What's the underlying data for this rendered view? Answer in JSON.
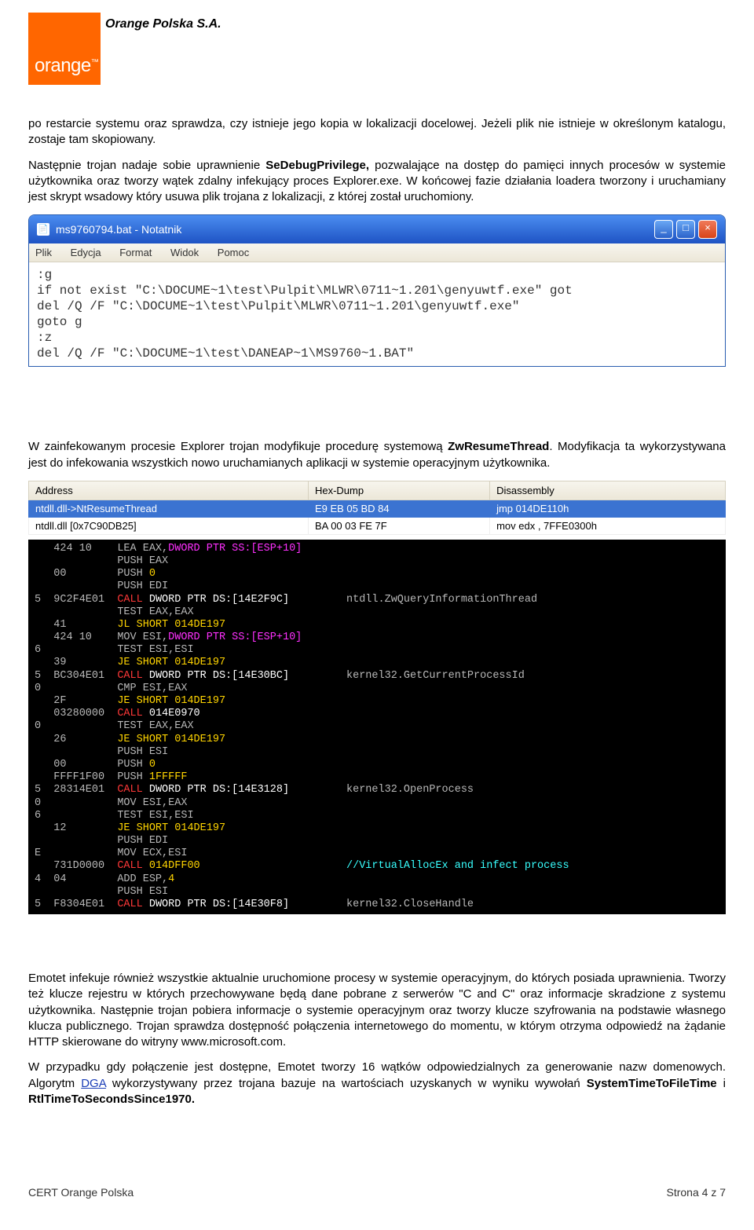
{
  "header": {
    "company": "Orange Polska S.A.",
    "logo_text": "orange",
    "tm": "™"
  },
  "para1_a": "po restarcie systemu oraz sprawdza, czy istnieje jego kopia w lokalizacji docelowej. Jeżeli plik nie istnieje w określonym katalogu, zostaje tam skopiowany.",
  "para2_a": "Następnie trojan nadaje sobie uprawnienie ",
  "para2_b": "SeDebugPrivilege,",
  "para2_c": " pozwalające na dostęp do pamięci innych procesów w systemie użytkownika oraz tworzy wątek zdalny infekujący proces Explorer.exe. W końcowej fazie działania loadera tworzony i uruchamiany jest skrypt wsadowy który usuwa plik trojana z lokalizacji, z której został uruchomiony.",
  "notepad": {
    "title": "ms9760794.bat - Notatnik",
    "menu": [
      "Plik",
      "Edycja",
      "Format",
      "Widok",
      "Pomoc"
    ],
    "content": ":g\nif not exist \"C:\\DOCUME~1\\test\\Pulpit\\MLWR\\0711~1.201\\genyuwtf.exe\" got\ndel /Q /F \"C:\\DOCUME~1\\test\\Pulpit\\MLWR\\0711~1.201\\genyuwtf.exe\"\ngoto g\n:z\ndel /Q /F \"C:\\DOCUME~1\\test\\DANEAP~1\\MS9760~1.BAT\""
  },
  "para3_a": "W zainfekowanym procesie Explorer trojan modyfikuje procedurę systemową ",
  "para3_b": "ZwResumeThread",
  "para3_c": ". Modyfikacja ta wykorzystywana jest do infekowania wszystkich nowo uruchamianych aplikacji w systemie operacyjnym użytkownika.",
  "table": {
    "headers": [
      "Address",
      "Hex-Dump",
      "Disassembly"
    ],
    "rows": [
      {
        "sel": true,
        "c": [
          "ntdll.dll->NtResumeThread",
          "E9 EB 05 BD 84",
          "jmp 014DE110h"
        ]
      },
      {
        "sel": false,
        "c": [
          "ntdll.dll [0x7C90DB25]",
          "BA 00 03 FE 7F",
          "mov edx , 7FFE0300h"
        ]
      }
    ]
  },
  "debugger_lines": [
    {
      "addr": "",
      "bytes": "424 10",
      "asm": [
        [
          "g",
          "LEA EAX,"
        ],
        [
          "mg",
          "DWORD PTR SS:[ESP+10]"
        ]
      ],
      "cmt": ""
    },
    {
      "addr": "",
      "bytes": "",
      "asm": [
        [
          "g",
          "PUSH EAX"
        ]
      ],
      "cmt": ""
    },
    {
      "addr": "",
      "bytes": "00",
      "asm": [
        [
          "g",
          "PUSH "
        ],
        [
          "y",
          "0"
        ]
      ],
      "cmt": ""
    },
    {
      "addr": "",
      "bytes": "",
      "asm": [
        [
          "g",
          "PUSH EDI"
        ]
      ],
      "cmt": ""
    },
    {
      "addr": "5",
      "bytes": "9C2F4E01",
      "asm": [
        [
          "r",
          "CALL "
        ],
        [
          "w",
          "DWORD PTR DS:[14E2F9C]"
        ]
      ],
      "cmt": "ntdll.ZwQueryInformationThread"
    },
    {
      "addr": "",
      "bytes": "",
      "asm": [
        [
          "g",
          "TEST EAX,EAX"
        ]
      ],
      "cmt": ""
    },
    {
      "addr": "",
      "bytes": "41",
      "asm": [
        [
          "y",
          "JL SHORT 014DE197"
        ]
      ],
      "cmt": ""
    },
    {
      "addr": "",
      "bytes": "424 10",
      "asm": [
        [
          "g",
          "MOV ESI,"
        ],
        [
          "mg",
          "DWORD PTR SS:[ESP+10]"
        ]
      ],
      "cmt": ""
    },
    {
      "addr": "6",
      "bytes": "",
      "asm": [
        [
          "g",
          "TEST ESI,ESI"
        ]
      ],
      "cmt": ""
    },
    {
      "addr": "",
      "bytes": "39",
      "asm": [
        [
          "y",
          "JE SHORT 014DE197"
        ]
      ],
      "cmt": ""
    },
    {
      "addr": "5",
      "bytes": "BC304E01",
      "asm": [
        [
          "r",
          "CALL "
        ],
        [
          "w",
          "DWORD PTR DS:[14E30BC]"
        ]
      ],
      "cmt": "kernel32.GetCurrentProcessId"
    },
    {
      "addr": "0",
      "bytes": "",
      "asm": [
        [
          "g",
          "CMP ESI,EAX"
        ]
      ],
      "cmt": ""
    },
    {
      "addr": "",
      "bytes": "2F",
      "asm": [
        [
          "y",
          "JE SHORT 014DE197"
        ]
      ],
      "cmt": ""
    },
    {
      "addr": "",
      "bytes": "03280000",
      "asm": [
        [
          "r",
          "CALL "
        ],
        [
          "w",
          "014E0970"
        ]
      ],
      "cmt": ""
    },
    {
      "addr": "0",
      "bytes": "",
      "asm": [
        [
          "g",
          "TEST EAX,EAX"
        ]
      ],
      "cmt": ""
    },
    {
      "addr": "",
      "bytes": "26",
      "asm": [
        [
          "y",
          "JE SHORT 014DE197"
        ]
      ],
      "cmt": ""
    },
    {
      "addr": "",
      "bytes": "",
      "asm": [
        [
          "g",
          "PUSH ESI"
        ]
      ],
      "cmt": ""
    },
    {
      "addr": "",
      "bytes": "00",
      "asm": [
        [
          "g",
          "PUSH "
        ],
        [
          "y",
          "0"
        ]
      ],
      "cmt": ""
    },
    {
      "addr": "",
      "bytes": "FFFF1F00",
      "asm": [
        [
          "g",
          "PUSH "
        ],
        [
          "y",
          "1FFFFF"
        ]
      ],
      "cmt": ""
    },
    {
      "addr": "5",
      "bytes": "28314E01",
      "asm": [
        [
          "r",
          "CALL "
        ],
        [
          "w",
          "DWORD PTR DS:[14E3128]"
        ]
      ],
      "cmt": "kernel32.OpenProcess"
    },
    {
      "addr": "0",
      "bytes": "",
      "asm": [
        [
          "g",
          "MOV ESI,EAX"
        ]
      ],
      "cmt": ""
    },
    {
      "addr": "6",
      "bytes": "",
      "asm": [
        [
          "g",
          "TEST ESI,ESI"
        ]
      ],
      "cmt": ""
    },
    {
      "addr": "",
      "bytes": "12",
      "asm": [
        [
          "y",
          "JE SHORT 014DE197"
        ]
      ],
      "cmt": ""
    },
    {
      "addr": "",
      "bytes": "",
      "asm": [
        [
          "g",
          "PUSH EDI"
        ]
      ],
      "cmt": ""
    },
    {
      "addr": "E",
      "bytes": "",
      "asm": [
        [
          "g",
          "MOV ECX,ESI"
        ]
      ],
      "cmt": ""
    },
    {
      "addr": "",
      "bytes": "731D0000",
      "asm": [
        [
          "r",
          "CALL "
        ],
        [
          "y",
          "014DFF00"
        ]
      ],
      "cmt": "//VirtualAllocEx and infect process",
      "cmtclass": "cy"
    },
    {
      "addr": "4",
      "bytes": "04",
      "asm": [
        [
          "g",
          "ADD ESP,"
        ],
        [
          "y",
          "4"
        ]
      ],
      "cmt": ""
    },
    {
      "addr": "",
      "bytes": "",
      "asm": [
        [
          "g",
          "PUSH ESI"
        ]
      ],
      "cmt": ""
    },
    {
      "addr": "5",
      "bytes": "F8304E01",
      "asm": [
        [
          "r",
          "CALL "
        ],
        [
          "w",
          "DWORD PTR DS:[14E30F8]"
        ]
      ],
      "cmt": "kernel32.CloseHandle"
    }
  ],
  "para4": "Emotet infekuje również wszystkie aktualnie uruchomione procesy w systemie operacyjnym, do których posiada uprawnienia. Tworzy też klucze rejestru w których przechowywane będą dane pobrane z serwerów \"C and C\" oraz informacje skradzione z systemu użytkownika. Następnie trojan pobiera informacje o systemie operacyjnym oraz tworzy klucze szyfrowania na podstawie własnego klucza publicznego. Trojan sprawdza dostępność połączenia internetowego do momentu, w którym otrzyma odpowiedź na żądanie HTTP skierowane do witryny www.microsoft.com.",
  "para5_a": "W przypadku gdy połączenie jest dostępne, Emotet tworzy 16 wątków odpowiedzialnych za generowanie nazw domenowych. Algorytm ",
  "para5_link": "DGA",
  "para5_b": " wykorzystywany przez trojana bazuje na wartościach uzyskanych w wyniku wywołań ",
  "para5_c": "SystemTimeToFileTime",
  "para5_d": " i ",
  "para5_e": "RtlTimeToSecondsSince1970.",
  "footer": {
    "left": "CERT Orange Polska",
    "right": "Strona 4 z 7"
  }
}
